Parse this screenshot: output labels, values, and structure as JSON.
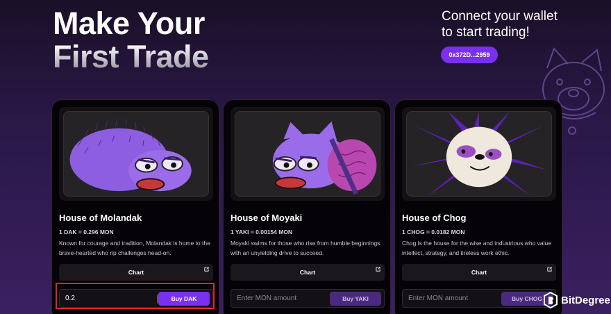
{
  "hero": {
    "line1": "Make Your",
    "line2": "First Trade"
  },
  "connect": {
    "line1": "Connect your wallet",
    "line2": "to start trading!",
    "wallet_address": "0x372D...2959"
  },
  "colors": {
    "accent": "#7b2ff0",
    "highlight": "#e0242c"
  },
  "cards": [
    {
      "title": "House of Molandak",
      "price": "1 DAK = 0.296 MON",
      "description": "Known for courage and tradition, Molandak is home to the brave-hearted who rip challenges head-on.",
      "chart_label": "Chart",
      "amount_value": "0.2",
      "amount_placeholder": "Enter MON amount",
      "buy_label": "Buy DAK",
      "image_icon": "hedgehog-frog-icon"
    },
    {
      "title": "House of Moyaki",
      "price": "1 YAKI = 0.00154 MON",
      "description": "Moyaki swims for those who rise from humble beginnings with an unyielding drive to succeed.",
      "chart_label": "Chart",
      "amount_value": "",
      "amount_placeholder": "Enter MON amount",
      "buy_label": "Buy YAKI",
      "image_icon": "cat-fish-frog-icon"
    },
    {
      "title": "House of Chog",
      "price": "1 CHOG = 0.0182 MON",
      "description": "Chog is the house for the wise and industrious who value intellect, strategy, and tireless work ethic.",
      "chart_label": "Chart",
      "amount_value": "",
      "amount_placeholder": "Enter MON amount",
      "buy_label": "Buy CHOG",
      "image_icon": "chog-face-icon"
    }
  ],
  "watermark": {
    "text": "BitDegree"
  }
}
